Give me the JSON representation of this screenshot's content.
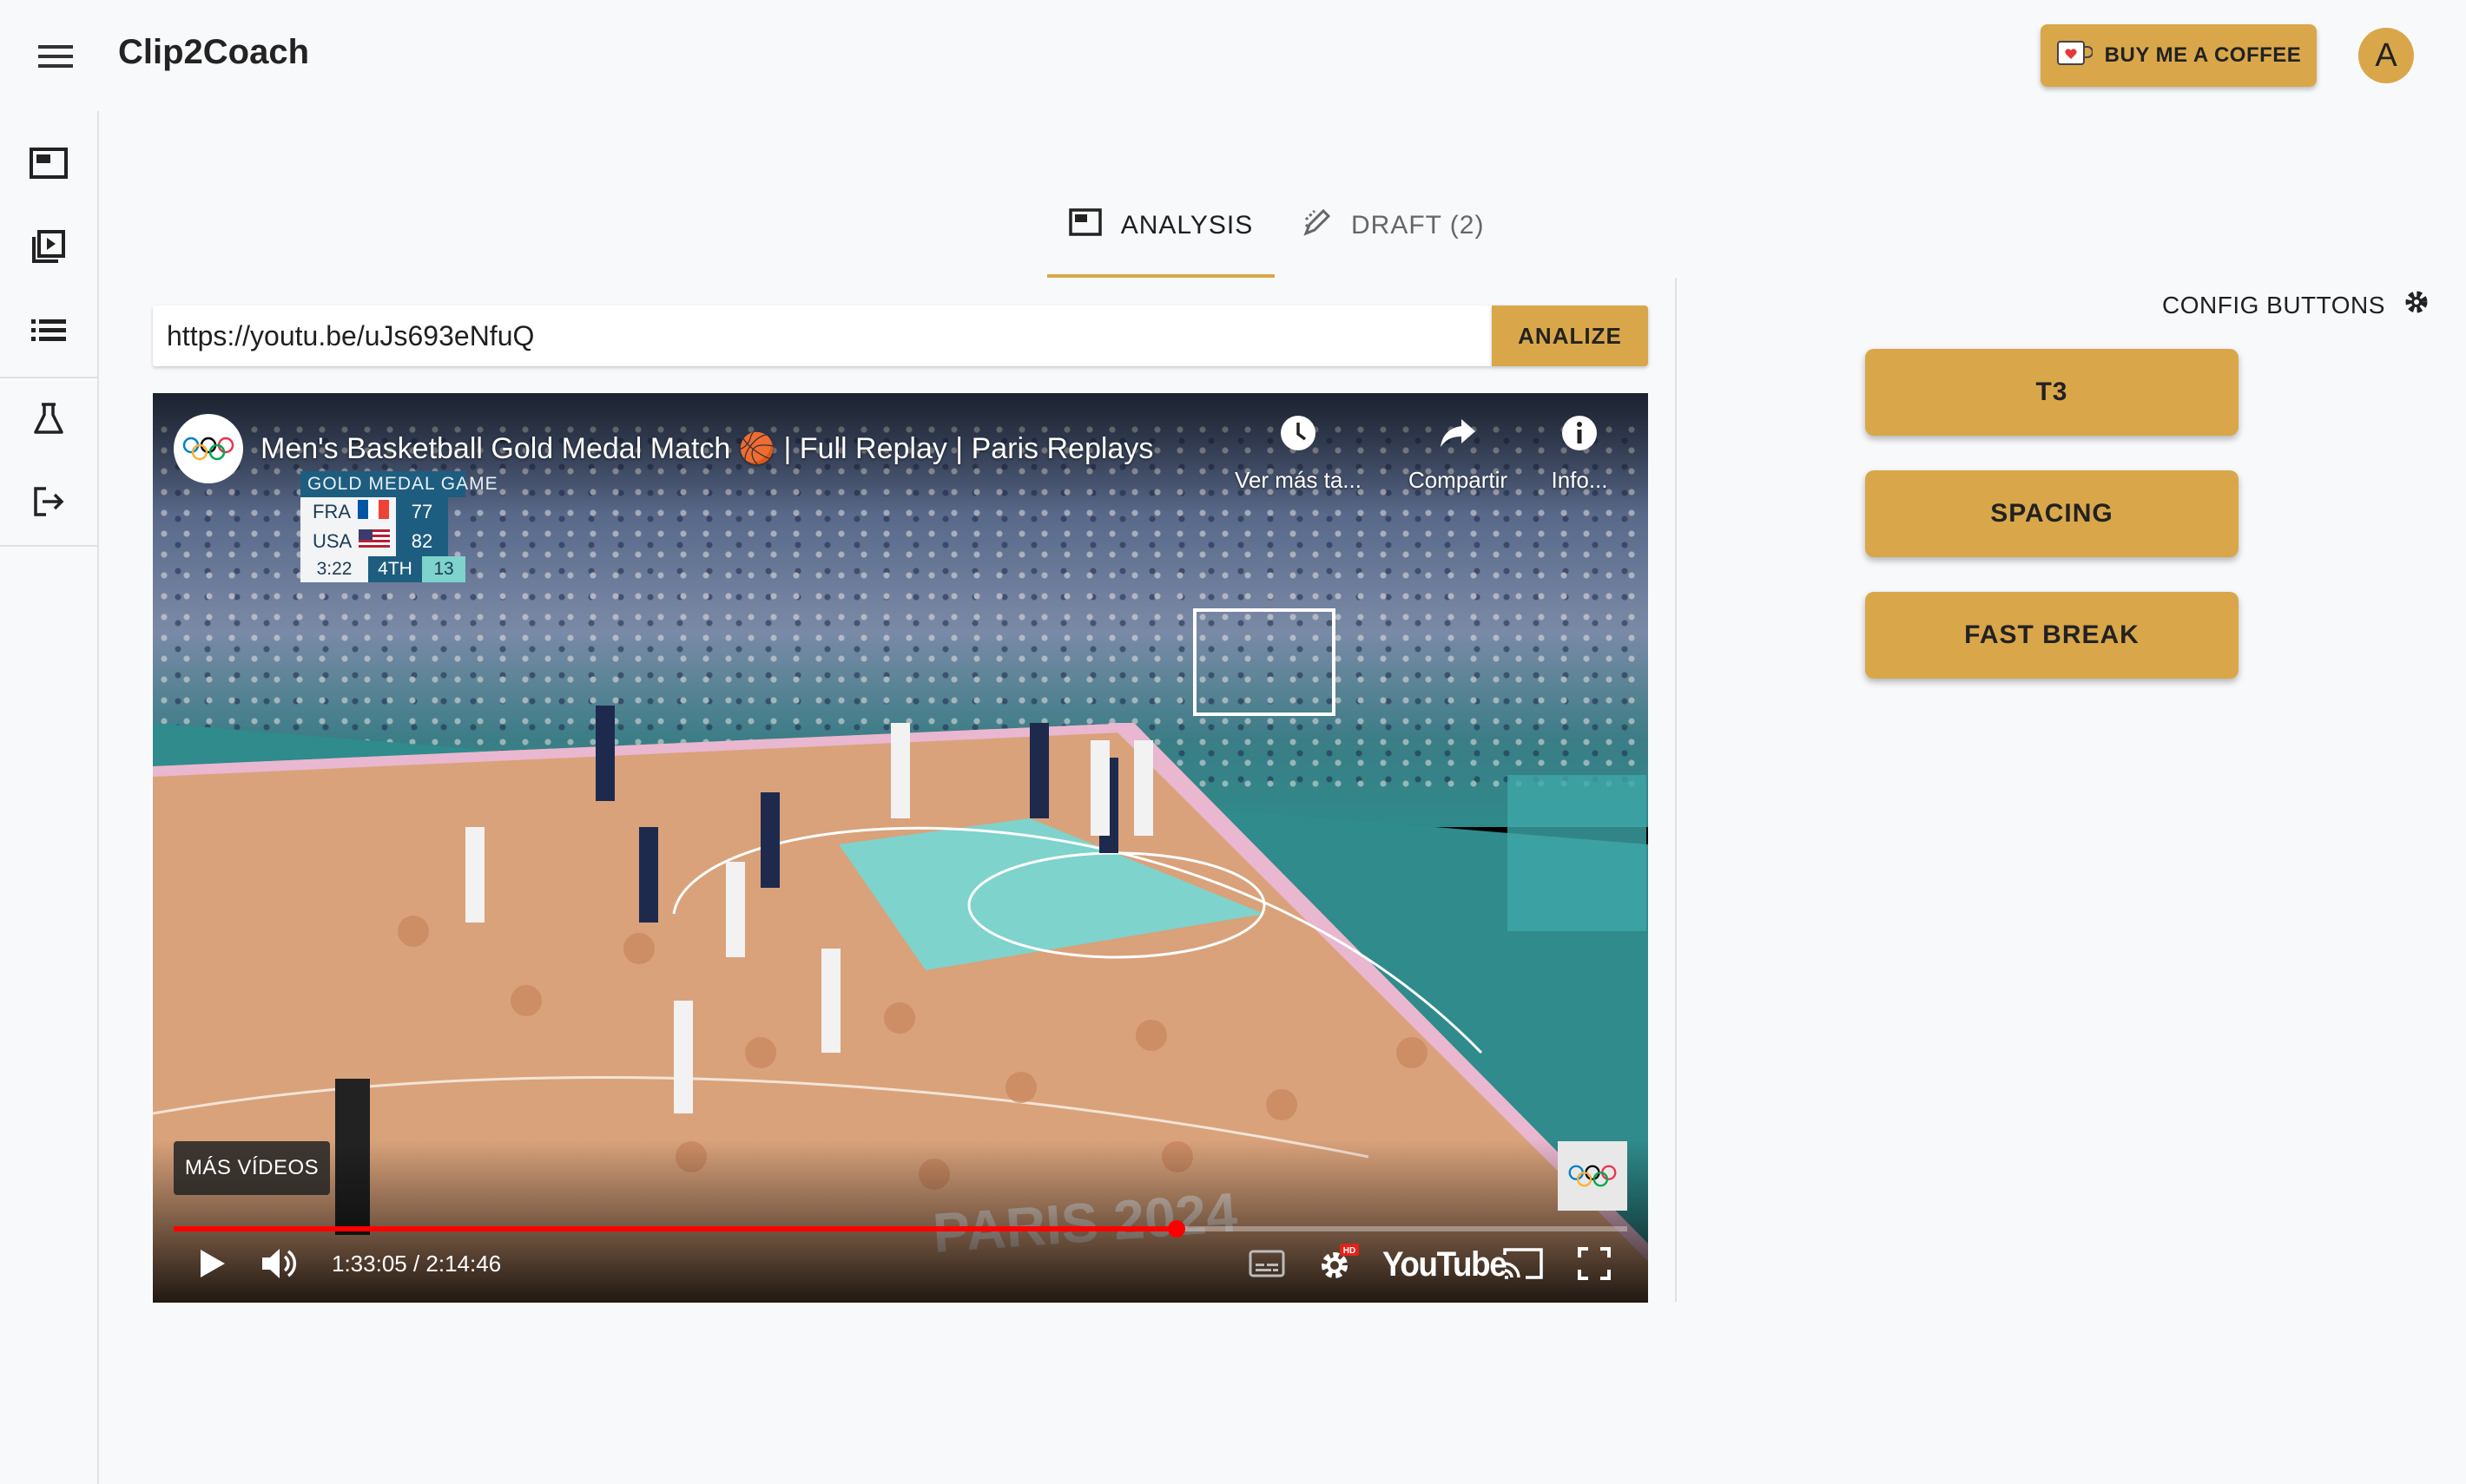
{
  "app": {
    "title": "Clip2Coach",
    "coffee_label": "BUY ME A COFFEE",
    "avatar_initial": "A",
    "accent_color": "#d9a74a"
  },
  "sidebar": {
    "items": [
      {
        "icon": "analysis-icon"
      },
      {
        "icon": "video-library-icon"
      },
      {
        "icon": "list-icon"
      },
      {
        "icon": "flask-icon"
      },
      {
        "icon": "logout-icon"
      }
    ]
  },
  "tabs": [
    {
      "label": "ANALYSIS",
      "icon": "analysis-icon",
      "active": true
    },
    {
      "label": "DRAFT (2)",
      "icon": "draft-edit-icon",
      "active": false
    }
  ],
  "url_bar": {
    "value": "https://youtu.be/uJs693eNfuQ",
    "button_label": "ANALIZE"
  },
  "video": {
    "title": "Men's Basketball Gold Medal Match 🏀 | Full Replay | Paris Replays",
    "top_actions": [
      {
        "label": "Ver más ta...",
        "icon": "clock-icon"
      },
      {
        "label": "Compartir",
        "icon": "share-icon"
      },
      {
        "label": "Info...",
        "icon": "info-icon"
      }
    ],
    "scorebug": {
      "header": "GOLD MEDAL GAME",
      "team1": "FRA",
      "score1": "77",
      "team2": "USA",
      "score2": "82",
      "clock": "3:22",
      "period": "4TH",
      "shot_clock": "13"
    },
    "more_videos_label": "MÁS VÍDEOS",
    "time_display": "1:33:05 / 2:14:46",
    "progress_fraction": 0.69,
    "youtube_label": "YouTube",
    "hd_badge": "HD"
  },
  "config": {
    "label": "CONFIG BUTTONS",
    "buttons": [
      "T3",
      "SPACING",
      "FAST BREAK"
    ]
  }
}
